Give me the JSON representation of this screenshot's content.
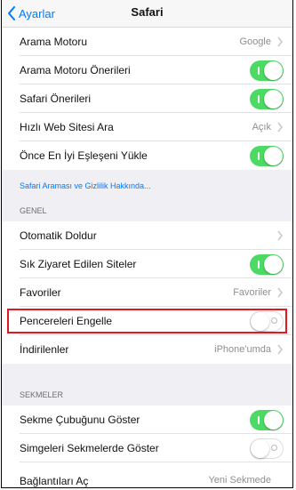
{
  "nav": {
    "back_label": "Ayarlar",
    "title": "Safari"
  },
  "rows": {
    "search_engine": {
      "label": "Arama Motoru",
      "value": "Google"
    },
    "search_suggestions": {
      "label": "Arama Motoru Önerileri",
      "toggle": "on"
    },
    "safari_suggestions": {
      "label": "Safari Önerileri",
      "toggle": "on"
    },
    "quick_search": {
      "label": "Hızlı Web Sitesi Ara",
      "value": "Açık"
    },
    "preload_top_hit": {
      "label": "Önce En İyi Eşleşeni Yükle",
      "toggle": "on"
    },
    "privacy_link": {
      "label": "Safari Araması ve Gizlilik Hakkında..."
    },
    "general_header": {
      "label": "GENEL"
    },
    "autofill": {
      "label": "Otomatik Doldur"
    },
    "frequent_sites": {
      "label": "Sık Ziyaret Edilen Siteler",
      "toggle": "on"
    },
    "favorites": {
      "label": "Favoriler",
      "value": "Favoriler"
    },
    "block_popups": {
      "label": "Pencereleri Engelle",
      "toggle": "off"
    },
    "downloads": {
      "label": "İndirilenler",
      "value": "iPhone'umda"
    },
    "tabs_header": {
      "label": "SEKMELER"
    },
    "show_tab_bar": {
      "label": "Sekme Çubuğunu Göster",
      "toggle": "on"
    },
    "show_icons_in_tabs": {
      "label": "Simgeleri Sekmelerde Göster",
      "toggle": "off"
    },
    "open_links": {
      "label": "Bağlantıları Aç",
      "value": "Yeni Sekmede"
    }
  },
  "colors": {
    "accent": "#007aff",
    "toggle_on": "#4cd964",
    "highlight": "#e5161c"
  }
}
